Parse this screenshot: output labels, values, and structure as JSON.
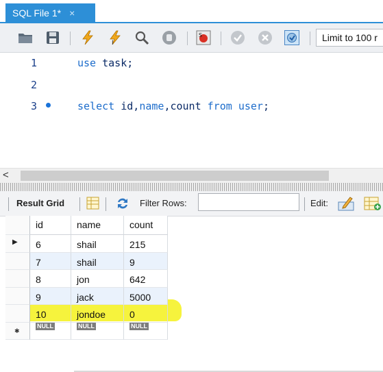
{
  "tab": {
    "title": "SQL File 1*",
    "close": "×"
  },
  "toolbar": {
    "limit_label": "Limit to 100 r",
    "icons": [
      "folder-icon",
      "save-icon",
      "execute-icon",
      "execute-current-icon",
      "explain-icon",
      "stop-icon",
      "toggle-error-icon",
      "commit-icon",
      "rollback-icon",
      "autocommit-icon"
    ]
  },
  "editor": {
    "lines": [
      {
        "num": "1",
        "tokens": [
          {
            "t": "use",
            "kw": true
          },
          {
            "t": " task;",
            "kw": false
          }
        ]
      },
      {
        "num": "2",
        "tokens": []
      },
      {
        "num": "3",
        "tokens": [
          {
            "t": "select",
            "kw": true
          },
          {
            "t": " id,",
            "kw": false
          },
          {
            "t": "name",
            "kw": true
          },
          {
            "t": ",count ",
            "kw": false
          },
          {
            "t": "from",
            "kw": true
          },
          {
            "t": " ",
            "kw": false
          },
          {
            "t": "user",
            "kw": true
          },
          {
            "t": ";",
            "kw": false
          }
        ]
      }
    ]
  },
  "scrollbar": {
    "left_arrow": "<"
  },
  "result_toolbar": {
    "result_grid_label": "Result Grid",
    "filter_label": "Filter Rows:",
    "filter_value": "",
    "edit_label": "Edit:"
  },
  "grid": {
    "columns": [
      "id",
      "name",
      "count"
    ],
    "rows": [
      {
        "cells": [
          "6",
          "shail",
          "215"
        ],
        "current": true
      },
      {
        "cells": [
          "7",
          "shail",
          "9"
        ]
      },
      {
        "cells": [
          "8",
          "jon",
          "642"
        ]
      },
      {
        "cells": [
          "9",
          "jack",
          "5000"
        ]
      },
      {
        "cells": [
          "10",
          "jondoe",
          "0"
        ],
        "highlighted": true
      }
    ],
    "new_row": [
      "NULL",
      "NULL",
      "NULL"
    ],
    "highlight_color": "#f5f22e"
  },
  "colors": {
    "tab_accent": "#2d8fd7",
    "keyword": "#1c6ccb",
    "text": "#0a2a66"
  }
}
